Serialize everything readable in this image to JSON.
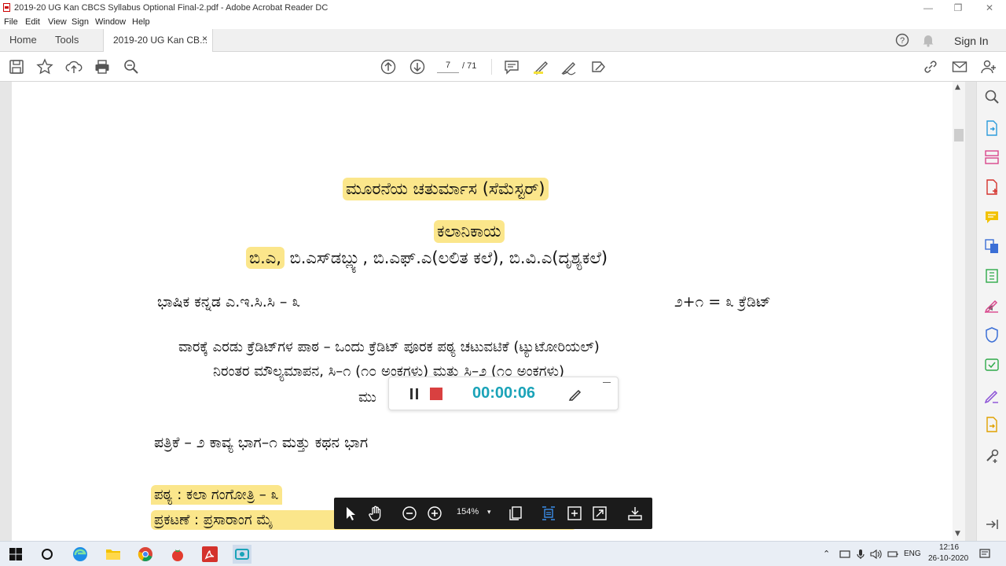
{
  "window": {
    "title": "2019-20 UG Kan CBCS Syllabus Optional Final-2.pdf - Adobe Acrobat Reader DC",
    "minimize": "—",
    "maximize": "❐",
    "close": "✕"
  },
  "menu": [
    "File",
    "Edit",
    "View",
    "Sign",
    "Window",
    "Help"
  ],
  "tabs": {
    "home": "Home",
    "tools": "Tools",
    "document": "2019-20 UG Kan CB...",
    "close": "×",
    "sign_in": "Sign In"
  },
  "toolbar": {
    "page_current": "7",
    "page_total": "/ 71"
  },
  "document": {
    "heading": "ಮೂರನೆಯ ಚತುರ್ಮಾಸ (ಸೆಮೆಸ್ಟರ್)",
    "faculty": "ಕಲಾನಿಕಾಯ",
    "degrees_hl": "ಬಿ.ಎ,",
    "degrees_rest": " ಬಿ.ಎಸ್‌ಡಬ್ಲ್ಯು, ಬಿ.ಎಫ್.ಎ(ಲಲಿತ ಕಲೆ), ಬಿ.ವಿ.ಎ(ದೃಶ್ಯಕಲೆ)",
    "course_left": "ಭಾಷಿಕ ಕನ್ನಡ ಎ.ಇ.ಸಿ.ಸಿ – ೩",
    "course_right": "೨+೧ = ೩ ಕ್ರೆಡಿಟ್",
    "weekly": "ವಾರಕ್ಕೆ ಎರಡು ಕ್ರೆಡಿಟ್‌ಗಳ ಪಾಠ – ಒಂದು ಕ್ರೆಡಿಟ್ ಪೂರಕ ಪಠ್ಯ ಚಟುವಟಿಕೆ (ಟ್ಯುಟೋರಿಯಲ್)",
    "evaluation": "ನಿರಂತರ ಮೌಲ್ಯಮಾಪನ, ಸಿ–೧ (೧೦ ಅಂಕಗಳು) ಮತ್ತು ಸಿ–೨ (೧೦ ಅಂಕಗಳು)",
    "partial": "ಮು",
    "paper": "ಪತ್ರಿಕೆ – ೨ ಕಾವ್ಯ ಭಾಗ–೧ ಮತ್ತು ಕಥನ ಭಾಗ",
    "text_book": "ಪಠ್ಯ : ಕಲಾ ಗಂಗೋತ್ರಿ – ೩",
    "publisher": "ಪ್ರಕಟಣೆ : ಪ್ರಸಾರಾಂಗ ಮೈ"
  },
  "recorder": {
    "timer": "00:00:06"
  },
  "floatbar": {
    "zoom": "154%"
  },
  "taskbar": {
    "language": "ENG",
    "time": "12:16",
    "date": "26-10-2020"
  },
  "colors": {
    "highlight": "#fbe68b",
    "timer": "#1aa3b8",
    "acrobat_red": "#d4322c"
  }
}
